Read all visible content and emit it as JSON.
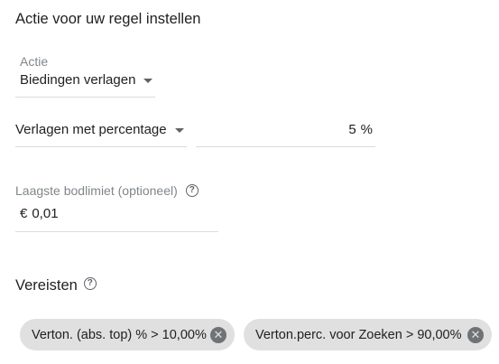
{
  "section": {
    "title": "Actie voor uw regel instellen"
  },
  "action": {
    "label": "Actie",
    "selected": "Biedingen verlagen"
  },
  "adjustment": {
    "mode_selected": "Verlagen met percentage",
    "percentage_value": "5",
    "percentage_unit": "%"
  },
  "bid_limit": {
    "label": "Laagste bodlimiet (optioneel)",
    "currency": "€",
    "value": "0,01",
    "help_glyph": "?"
  },
  "requirements": {
    "title": "Vereisten",
    "help_glyph": "?",
    "chips": [
      {
        "label": "Verton. (abs. top) % > 10,00%",
        "remove_glyph": "✕"
      },
      {
        "label": "Verton.perc. voor Zoeken > 90,00%",
        "remove_glyph": "✕"
      }
    ]
  },
  "colors": {
    "text": "#202124",
    "label": "#80868b",
    "divider": "#dadce0",
    "chip_bg": "#e0e0e0",
    "chip_icon": "#6f7377"
  },
  "icons": {
    "dropdown": "caret-down-icon",
    "help": "help-circle-icon",
    "remove": "cancel-circle-icon"
  }
}
